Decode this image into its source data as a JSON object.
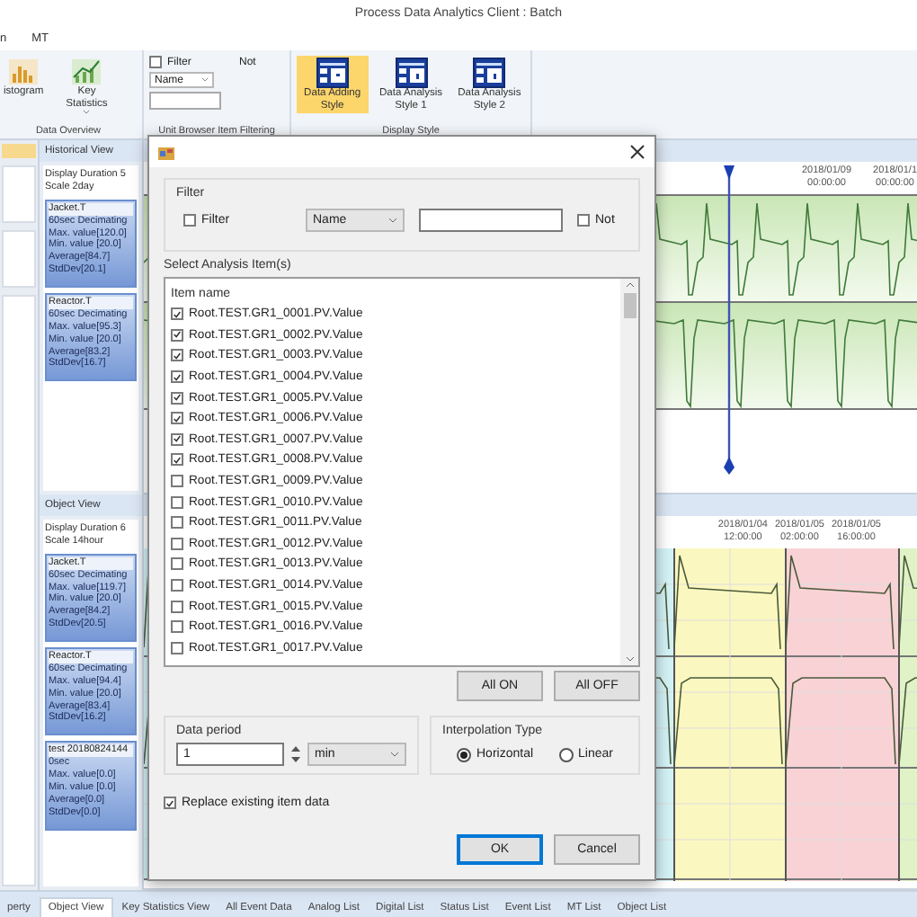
{
  "window": {
    "title": "Process Data Analytics Client : Batch"
  },
  "menu": [
    "n",
    "MT"
  ],
  "ribbon": {
    "overview": {
      "label": "Data Overview",
      "buttons": [
        {
          "label": "istogram",
          "kind": "histogram",
          "dropdown": false
        },
        {
          "label": "Key Statistics",
          "kind": "statistics",
          "dropdown": true
        }
      ]
    },
    "filtering": {
      "label": "Unit Browser Item Filtering",
      "filter": {
        "label": "Filter",
        "checked": false
      },
      "select": "Name",
      "not_label": "Not"
    },
    "display": {
      "label": "Display Style",
      "buttons": [
        {
          "label": "Data Adding Style",
          "selected": true
        },
        {
          "label": "Data Analysis Style 1",
          "selected": false
        },
        {
          "label": "Data Analysis Style 2",
          "selected": false
        }
      ]
    }
  },
  "stat_panels": [
    {
      "title": "Historical View",
      "duration": "Display Duration 5",
      "scale": "Scale 2day",
      "blocks": [
        {
          "name": "Jacket.T",
          "lines": [
            "60sec Decimating",
            "Max. value[120.0]",
            "Min. value [20.0]",
            "Average[84.7]",
            "StdDev[20.1]"
          ]
        },
        {
          "name": "Reactor.T",
          "lines": [
            "60sec Decimating",
            "Max. value[95.3]",
            "Min. value [20.0]",
            "Average[83.2]",
            "StdDev[16.7]"
          ]
        }
      ]
    },
    {
      "title": "Object View",
      "duration": "Display Duration 6",
      "scale": "Scale 14hour",
      "blocks": [
        {
          "name": "Jacket.T",
          "lines": [
            "60sec Decimating",
            "Max. value[119.7]",
            "Min. value [20.0]",
            "Average[84.2]",
            "StdDev[20.5]"
          ]
        },
        {
          "name": "Reactor.T",
          "lines": [
            "60sec Decimating",
            "Max. value[94.4]",
            "Min. value [20.0]",
            "Average[83.4]",
            "StdDev[16.2]"
          ]
        },
        {
          "name": "test 20180824144",
          "lines": [
            "0sec",
            "Max. value[0.0]",
            "Min. value [0.0]",
            "Average[0.0]",
            "StdDev[0.0]"
          ]
        }
      ]
    }
  ],
  "charts": [
    {
      "axis_labels": [
        {
          "date": "2018/01/09",
          "time": "00:00:00"
        },
        {
          "date": "2018/01/1",
          "time": "00:00:00"
        }
      ]
    },
    {
      "axis_labels": [
        {
          "date": "2018/01/04",
          "time": "12:00:00"
        },
        {
          "date": "2018/01/05",
          "time": "02:00:00"
        },
        {
          "date": "2018/01/05",
          "time": "16:00:00"
        }
      ]
    }
  ],
  "dialog": {
    "filter_group": {
      "title": "Filter",
      "filter_checkbox": {
        "label": "Filter",
        "checked": false
      },
      "select": "Name",
      "not_checkbox": {
        "label": "Not",
        "checked": false
      }
    },
    "items_group": {
      "title": "Select Analysis Item(s)",
      "column": "Item name",
      "items": [
        {
          "label": "Root.TEST.GR1_0001.PV.Value",
          "checked": true
        },
        {
          "label": "Root.TEST.GR1_0002.PV.Value",
          "checked": true
        },
        {
          "label": "Root.TEST.GR1_0003.PV.Value",
          "checked": true
        },
        {
          "label": "Root.TEST.GR1_0004.PV.Value",
          "checked": true
        },
        {
          "label": "Root.TEST.GR1_0005.PV.Value",
          "checked": true
        },
        {
          "label": "Root.TEST.GR1_0006.PV.Value",
          "checked": true
        },
        {
          "label": "Root.TEST.GR1_0007.PV.Value",
          "checked": true
        },
        {
          "label": "Root.TEST.GR1_0008.PV.Value",
          "checked": true
        },
        {
          "label": "Root.TEST.GR1_0009.PV.Value",
          "checked": false
        },
        {
          "label": "Root.TEST.GR1_0010.PV.Value",
          "checked": false
        },
        {
          "label": "Root.TEST.GR1_0011.PV.Value",
          "checked": false
        },
        {
          "label": "Root.TEST.GR1_0012.PV.Value",
          "checked": false
        },
        {
          "label": "Root.TEST.GR1_0013.PV.Value",
          "checked": false
        },
        {
          "label": "Root.TEST.GR1_0014.PV.Value",
          "checked": false
        },
        {
          "label": "Root.TEST.GR1_0015.PV.Value",
          "checked": false
        },
        {
          "label": "Root.TEST.GR1_0016.PV.Value",
          "checked": false
        },
        {
          "label": "Root.TEST.GR1_0017.PV.Value",
          "checked": false
        }
      ]
    },
    "all_on": "All ON",
    "all_off": "All OFF",
    "data_period": {
      "title": "Data period",
      "value": "1",
      "unit": "min"
    },
    "interpolation": {
      "title": "Interpolation Type",
      "options": [
        {
          "label": "Horizontal",
          "selected": true
        },
        {
          "label": "Linear",
          "selected": false
        }
      ]
    },
    "replace": {
      "label": "Replace existing item data",
      "checked": true
    },
    "ok": "OK",
    "cancel": "Cancel"
  },
  "bottom_tabs": [
    {
      "label": "perty",
      "selected": false
    },
    {
      "label": "Object View",
      "selected": true
    },
    {
      "label": "Key Statistics View",
      "selected": false
    },
    {
      "label": "All Event Data",
      "selected": false
    },
    {
      "label": "Analog List",
      "selected": false
    },
    {
      "label": "Digital List",
      "selected": false
    },
    {
      "label": "Status List",
      "selected": false
    },
    {
      "label": "Event List",
      "selected": false
    },
    {
      "label": "MT List",
      "selected": false
    },
    {
      "label": "Object List",
      "selected": false
    }
  ]
}
